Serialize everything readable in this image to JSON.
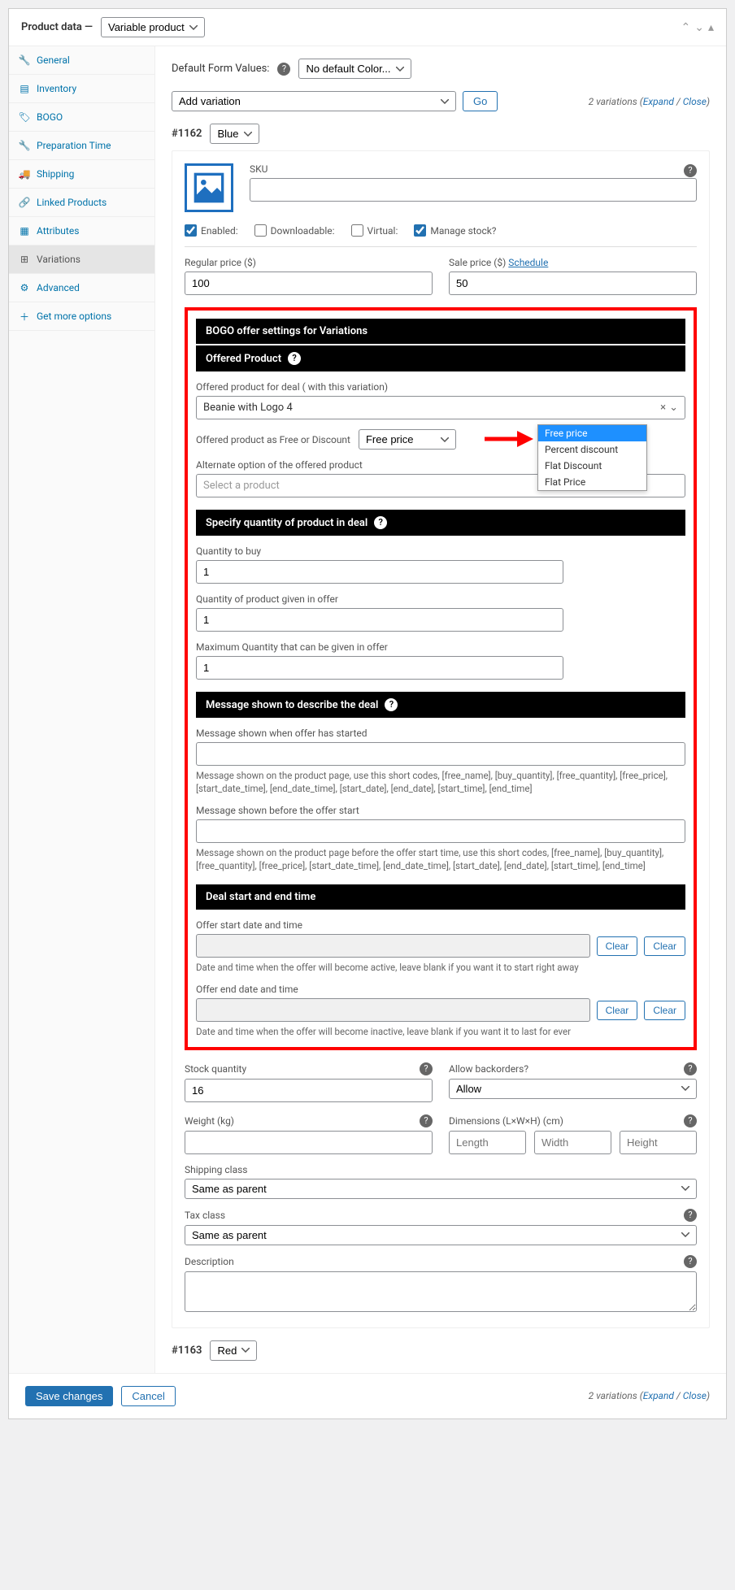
{
  "header": {
    "title": "Product data —",
    "type_select": "Variable product"
  },
  "sidebar": {
    "items": [
      {
        "label": "General"
      },
      {
        "label": "Inventory"
      },
      {
        "label": "BOGO"
      },
      {
        "label": "Preparation Time"
      },
      {
        "label": "Shipping"
      },
      {
        "label": "Linked Products"
      },
      {
        "label": "Attributes"
      },
      {
        "label": "Variations"
      },
      {
        "label": "Advanced"
      },
      {
        "label": "Get more options"
      }
    ]
  },
  "defaults": {
    "label": "Default Form Values:",
    "value": "No default Color..."
  },
  "toolbar": {
    "add": "Add variation",
    "go": "Go",
    "count": "2 variations",
    "expand": "Expand",
    "close": "Close"
  },
  "var1": {
    "id": "#1162",
    "attr": "Blue",
    "sku_label": "SKU",
    "enabled": "Enabled:",
    "downloadable": "Downloadable:",
    "virtual": "Virtual:",
    "managestock": "Manage stock?",
    "regular_label": "Regular price ($)",
    "regular_val": "100",
    "sale_label": "Sale price ($)",
    "schedule": "Schedule",
    "sale_val": "50",
    "bogo_title": "BOGO offer settings for Variations",
    "offered_title": "Offered Product",
    "offered_label": "Offered product for deal ( with this variation)",
    "offered_val": "Beanie with Logo 4",
    "freeor_label": "Offered product as Free or Discount",
    "freeor_val": "Free price",
    "freeor_opts": [
      "Free price",
      "Percent discount",
      "Flat Discount",
      "Flat Price"
    ],
    "alt_label": "Alternate option of the offered product",
    "alt_placeholder": "Select a product",
    "qty_title": "Specify quantity of product in deal",
    "qty_buy_label": "Quantity to buy",
    "qty_buy_val": "1",
    "qty_given_label": "Quantity of product given in offer",
    "qty_given_val": "1",
    "qty_max_label": "Maximum Quantity that can be given in offer",
    "qty_max_val": "1",
    "msg_title": "Message shown to describe the deal",
    "msg_started_label": "Message shown when offer has started",
    "msg_started_help": "Message shown on the product page, use this short codes, [free_name], [buy_quantity], [free_quantity], [free_price], [start_date_time], [end_date_time], [start_date], [end_date], [start_time], [end_time]",
    "msg_before_label": "Message shown before the offer start",
    "msg_before_help": "Message shown on the product page before the offer start time, use this short codes, [free_name], [buy_quantity], [free_quantity], [free_price], [start_date_time], [end_date_time], [start_date], [end_date], [start_time], [end_time]",
    "deal_title": "Deal start and end time",
    "start_label": "Offer start date and time",
    "clear": "Clear",
    "start_help": "Date and time when the offer will become active, leave blank if you want it to start right away",
    "end_label": "Offer end date and time",
    "end_help": "Date and time when the offer will become inactive, leave blank if you want it to last for ever",
    "stock_label": "Stock quantity",
    "stock_val": "16",
    "backorders_label": "Allow backorders?",
    "backorders_val": "Allow",
    "weight_label": "Weight (kg)",
    "dims_label": "Dimensions (L×W×H) (cm)",
    "len_ph": "Length",
    "wid_ph": "Width",
    "hei_ph": "Height",
    "shipclass_label": "Shipping class",
    "shipclass_val": "Same as parent",
    "taxclass_label": "Tax class",
    "taxclass_val": "Same as parent",
    "desc_label": "Description"
  },
  "var2": {
    "id": "#1163",
    "attr": "Red"
  },
  "footer": {
    "save": "Save changes",
    "cancel": "Cancel"
  }
}
